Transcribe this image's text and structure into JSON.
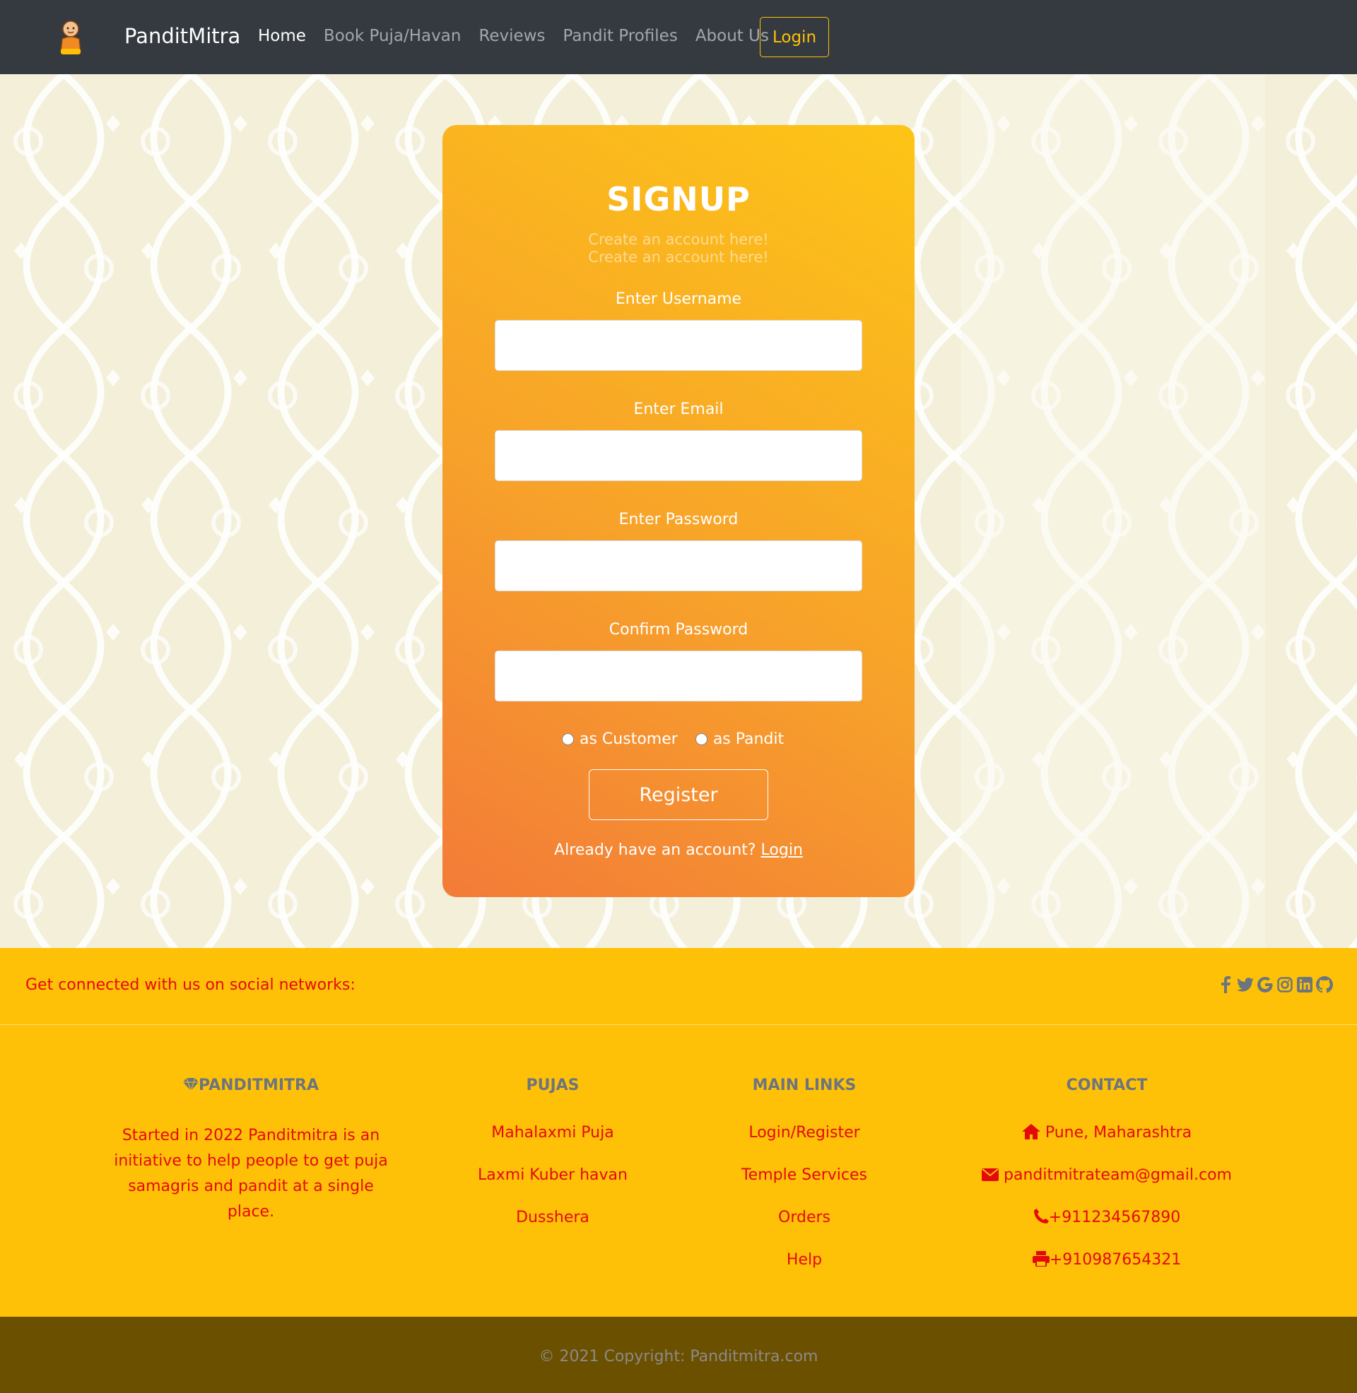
{
  "nav": {
    "brand": "PanditMitra",
    "links": [
      "Home",
      "Book Puja/Havan",
      "Reviews",
      "Pandit Profiles",
      "About Us"
    ],
    "login": "Login"
  },
  "signup": {
    "title": "SIGNUP",
    "subtitle_1": "Create an account here!",
    "subtitle_2": "Create an account here!",
    "username_label": "Enter Username",
    "email_label": "Enter Email",
    "password_label": "Enter Password",
    "confirm_label": "Confirm Password",
    "radio_customer": "as Customer",
    "radio_pandit": "as Pandit",
    "register": "Register",
    "already_text": "Already have an account?",
    "login_link": "Login"
  },
  "footer": {
    "social_text": "Get connected with us on social networks:",
    "social_icons": [
      "facebook-icon",
      "twitter-icon",
      "google-icon",
      "instagram-icon",
      "linkedin-icon",
      "github-icon"
    ],
    "brand_title": "PANDITMITRA",
    "brand_text": "Started in 2022 Panditmitra is an initiative to help people to get puja samagris and pandit at a single place.",
    "pujas_title": "PUJAS",
    "pujas": [
      "Mahalaxmi Puja",
      "Laxmi Kuber havan",
      "Dusshera"
    ],
    "links_title": "MAIN LINKS",
    "links": [
      "Login/Register",
      "Temple Services",
      "Orders",
      "Help"
    ],
    "contact_title": "CONTACT",
    "contact": {
      "address": "Pune, Maharashtra",
      "email": "panditmitrateam@gmail.com",
      "phone": "+911234567890",
      "fax": "+910987654321"
    },
    "copyright": "© 2021 Copyright: Panditmitra.com"
  },
  "colors": {
    "navbar": "#343a40",
    "accent": "#ffc107",
    "footer_text": "#e40a0a",
    "footer_bottom": "#6b5000"
  }
}
